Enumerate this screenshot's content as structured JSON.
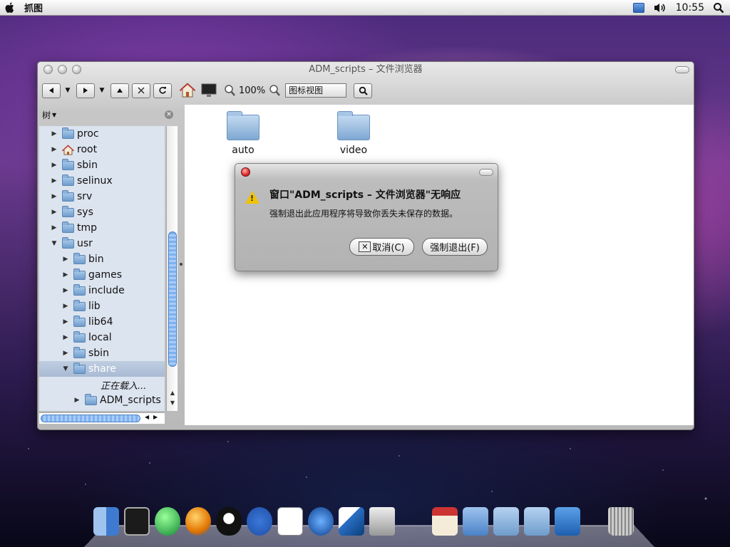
{
  "menubar": {
    "app_name": "抓图",
    "time": "10:55"
  },
  "window": {
    "title": "ADM_scripts  –  文件浏览器",
    "toolbar": {
      "zoom": "100%",
      "view_mode": "图标视图"
    },
    "sidebar": {
      "header": "树",
      "items": [
        {
          "label": "proc",
          "level": 0,
          "expanded": false,
          "icon": "folder-icon"
        },
        {
          "label": "root",
          "level": 0,
          "expanded": false,
          "icon": "home-folder-icon"
        },
        {
          "label": "sbin",
          "level": 0,
          "expanded": false,
          "icon": "folder-icon"
        },
        {
          "label": "selinux",
          "level": 0,
          "expanded": false,
          "icon": "folder-icon"
        },
        {
          "label": "srv",
          "level": 0,
          "expanded": false,
          "icon": "folder-icon"
        },
        {
          "label": "sys",
          "level": 0,
          "expanded": false,
          "icon": "folder-icon"
        },
        {
          "label": "tmp",
          "level": 0,
          "expanded": false,
          "icon": "folder-icon"
        },
        {
          "label": "usr",
          "level": 0,
          "expanded": true,
          "icon": "folder-icon"
        },
        {
          "label": "bin",
          "level": 1,
          "expanded": false,
          "icon": "folder-icon"
        },
        {
          "label": "games",
          "level": 1,
          "expanded": false,
          "icon": "folder-icon"
        },
        {
          "label": "include",
          "level": 1,
          "expanded": false,
          "icon": "folder-icon"
        },
        {
          "label": "lib",
          "level": 1,
          "expanded": false,
          "icon": "folder-icon"
        },
        {
          "label": "lib64",
          "level": 1,
          "expanded": false,
          "icon": "folder-icon"
        },
        {
          "label": "local",
          "level": 1,
          "expanded": false,
          "icon": "folder-icon"
        },
        {
          "label": "sbin",
          "level": 1,
          "expanded": false,
          "icon": "folder-icon"
        },
        {
          "label": "share",
          "level": 1,
          "expanded": true,
          "icon": "folder-icon",
          "selected": true
        }
      ],
      "loading_text": "正在载入...",
      "last_item": "ADM_scripts"
    },
    "content": {
      "folders": [
        "auto",
        "video"
      ]
    }
  },
  "dialog": {
    "title": "窗口\"ADM_scripts  –  文件浏览器\"无响应",
    "message": "强制退出此应用程序将导致你丢失未保存的数据。",
    "cancel_label": "取消(C)",
    "force_quit_label": "强制退出(F)"
  },
  "dock": {
    "icons": [
      "finder-icon",
      "terminal-icon",
      "globe-icon",
      "browser-icon",
      "qq-penguin-icon",
      "paw-icon",
      "textedit-icon",
      "media-player-icon",
      "quill-icon",
      "printer-icon",
      "home-folder-icon",
      "pictures-folder-icon",
      "documents-folder-icon",
      "public-folder-icon",
      "screenshot-icon",
      "trash-icon"
    ]
  }
}
